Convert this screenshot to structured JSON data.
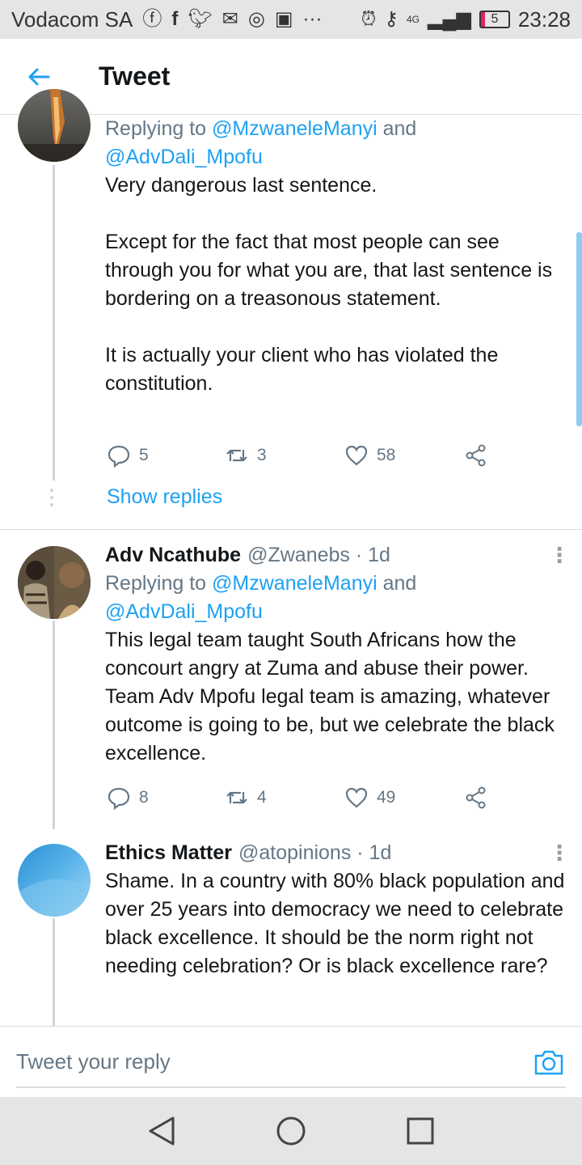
{
  "status_bar": {
    "carrier": "Vodacom SA",
    "network": "4G",
    "battery": "5",
    "time": "23:28"
  },
  "header": {
    "title": "Tweet",
    "back_icon": "arrow-left-icon"
  },
  "tweets": [
    {
      "reply_prefix": "Replying to ",
      "reply_user1": "@MzwaneleManyi",
      "reply_and": " and",
      "reply_user2": "@AdvDali_Mpofu",
      "text": "Very dangerous last sentence.\n\nExcept for the fact that most people can see through you for what you are, that last sentence is bordering on a treasonous statement.\n\nIt is actually your client who has violated the constitution.",
      "replies": "5",
      "retweets": "3",
      "likes": "58",
      "show_replies": "Show replies"
    },
    {
      "name": "Adv Ncathube",
      "handle": "@Zwanebs · 1d",
      "reply_prefix": "Replying to ",
      "reply_user1": "@MzwaneleManyi",
      "reply_and": " and",
      "reply_user2": "@AdvDali_Mpofu",
      "text": "This legal team taught South Africans how the concourt angry at Zuma and abuse their power. Team Adv Mpofu legal team is amazing, whatever outcome is going to be, but we celebrate the black excellence.",
      "replies": "8",
      "retweets": "4",
      "likes": "49"
    },
    {
      "name": "Ethics Matter",
      "handle": "@atopinions · 1d",
      "text": "Shame. In a country with 80% black population and over 25 years into democracy we need to celebrate black excellence. It should be the norm right not needing celebration? Or is black excellence rare?"
    }
  ],
  "reply_bar": {
    "placeholder": "Tweet your reply"
  },
  "colors": {
    "accent": "#1da1f2",
    "secondary_text": "#657786"
  }
}
